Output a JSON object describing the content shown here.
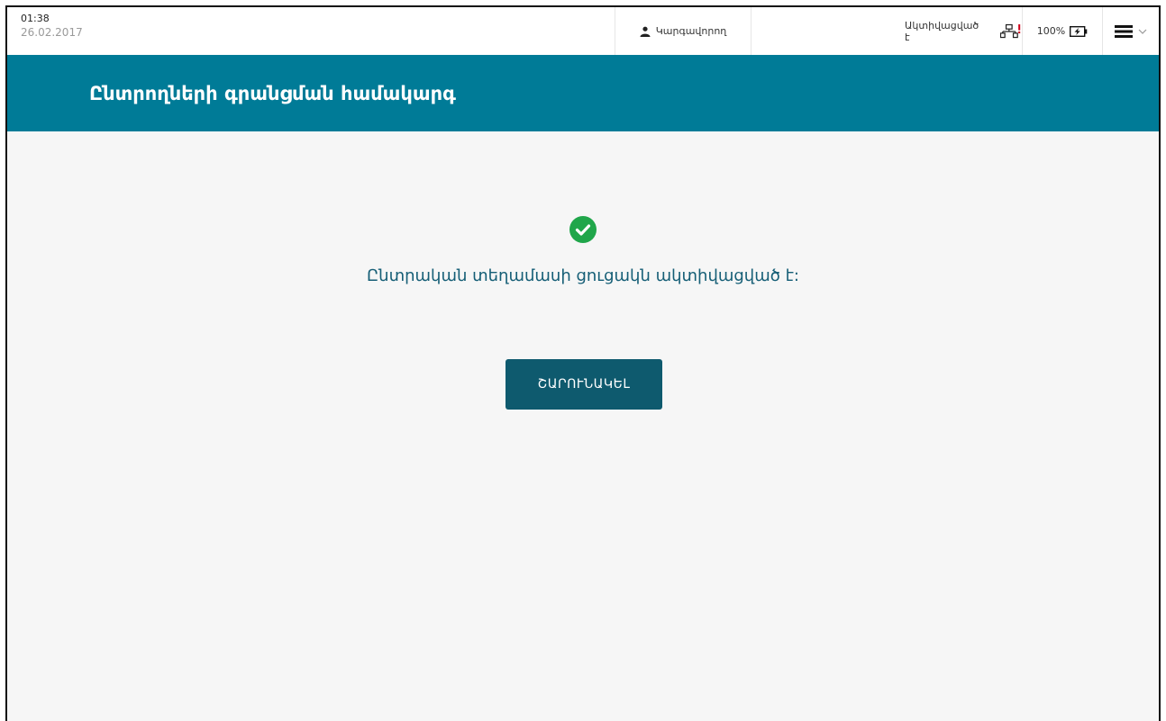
{
  "status_bar": {
    "time": "01:38",
    "date": "26.02.2017",
    "user_label": "Կարգավորող",
    "activation_status": "Ակտիվացված է",
    "battery_level": "100%",
    "network_icon": "network-warning-icon",
    "battery_icon": "battery-charging-icon",
    "menu_icon": "hamburger-icon"
  },
  "header": {
    "title": "Ընտրողների գրանցման համակարգ"
  },
  "main": {
    "message": "Ընտրական տեղամասի ցուցակն ակտիվացված է:",
    "continue_label": "ՇԱՐՈՒՆԱԿԵԼ"
  },
  "colors": {
    "header_bg": "#007b97",
    "button_bg": "#0e5a6e",
    "success": "#20a64a",
    "message_text": "#155e76",
    "network_alert": "#d0021b"
  }
}
